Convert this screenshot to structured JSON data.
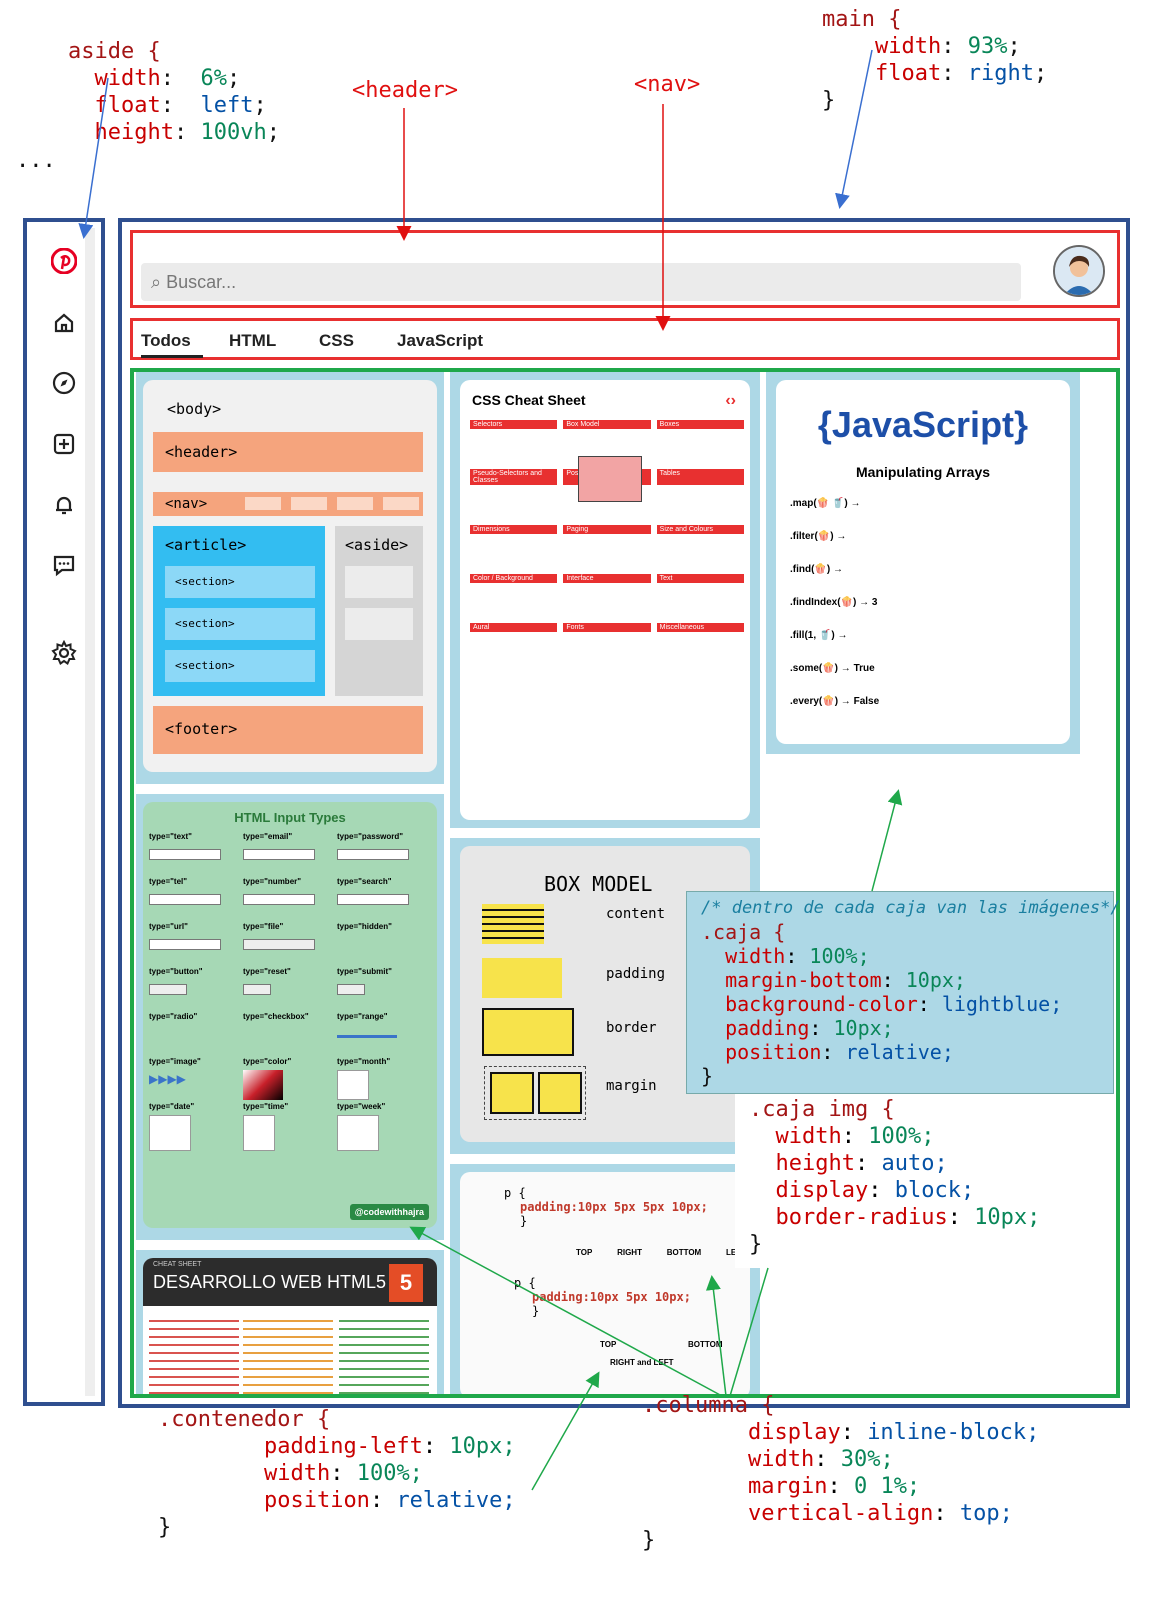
{
  "main_rule": {
    "selector": "main {",
    "l1_prop": "width",
    "l1_val": "93%",
    "l2_prop": "float",
    "l2_val": "right",
    "close": "}"
  },
  "aside_rule": {
    "selector": "aside {",
    "l1_prop": "width",
    "l1_val": "6%",
    "l2_prop": "float",
    "l2_val": "left",
    "l3_prop": "height",
    "l3_val": "100vh",
    "more": "..."
  },
  "labels": {
    "header": "<header>",
    "nav": "<nav>"
  },
  "header": {
    "search_placeholder": "⌕ Buscar..."
  },
  "nav": {
    "tabs": [
      "Todos",
      "HTML",
      "CSS",
      "JavaScript"
    ]
  },
  "aside_icons": [
    "pinterest-logo",
    "home-icon",
    "compass-icon",
    "add-square-icon",
    "bell-icon",
    "message-icon",
    "settings-icon"
  ],
  "images": {
    "layout": {
      "body": "<body>",
      "header": "<header>",
      "nav": "<nav>",
      "article": "<article>",
      "aside": "<aside>",
      "section": "<section>",
      "footer": "<footer>"
    },
    "css_cheat": {
      "title": "CSS Cheat Sheet",
      "sections": [
        "Selectors",
        "Box Model",
        "Boxes",
        "Pseudo-Selectors and Classes",
        "Positioning",
        "Tables",
        "Dimensions",
        "Paging",
        "Size and Colours",
        "Color / Background",
        "Interface",
        "Text",
        "Aural",
        "Fonts",
        "Miscellaneous"
      ]
    },
    "js_arrays": {
      "title": "{JavaScript}",
      "subtitle": "Manipulating Arrays",
      "rows": [
        ".map(🍿 🥤) →",
        ".filter(🍿) →",
        ".find(🍿) →",
        ".findIndex(🍿) → 3",
        ".fill(1, 🥤) →",
        ".some(🍿) → True",
        ".every(🍿) → False"
      ]
    },
    "html_inputs": {
      "title": "HTML Input Types",
      "items": [
        "type=\"text\"",
        "type=\"email\"",
        "type=\"password\"",
        "type=\"tel\"",
        "type=\"number\"",
        "type=\"search\"",
        "type=\"url\"",
        "type=\"file\"",
        "type=\"hidden\"",
        "type=\"button\"",
        "type=\"reset\"",
        "type=\"submit\"",
        "type=\"radio\"",
        "type=\"checkbox\"",
        "type=\"range\"",
        "type=\"image\"",
        "type=\"color\"",
        "type=\"month\"",
        "type=\"date\"",
        "type=\"time\"",
        "type=\"week\""
      ],
      "credit": "@codewithhajra"
    },
    "box_model": {
      "title": "BOX MODEL",
      "labels": [
        "content",
        "padding",
        "border",
        "margin"
      ]
    },
    "padding_demo": {
      "line1": "padding:10px 5px 5px 10px;",
      "labels1": [
        "TOP",
        "RIGHT",
        "BOTTOM",
        "LEFT"
      ],
      "line2": "padding:10px 5px 10px;",
      "labels2": [
        "TOP",
        "BOTTOM",
        "RIGHT and LEFT"
      ]
    },
    "html5": {
      "title": "DESARROLLO WEB HTML5",
      "sub": "CHEAT SHEET"
    }
  },
  "caja_rule": {
    "comment": "/* dentro de cada caja van las imágenes*/",
    "selector": ".caja {",
    "p1": "width",
    "v1": "100%;",
    "p2": "margin-bottom",
    "v2": "10px;",
    "p3": "background-color",
    "v3": "lightblue;",
    "p4": "padding",
    "v4": "10px;",
    "p5": "position",
    "v5": "relative;",
    "close": "}"
  },
  "caja_img_rule": {
    "selector": ".caja img {",
    "p1": "width",
    "v1": "100%;",
    "p2": "height",
    "v2": "auto;",
    "p3": "display",
    "v3": "block;",
    "p4": "border-radius",
    "v4": "10px;",
    "close": "}"
  },
  "contenedor_rule": {
    "selector": ".contenedor {",
    "p1": "padding-left",
    "v1": "10px;",
    "p2": "width",
    "v2": "100%;",
    "p3": "position",
    "v3": "relative;",
    "close": "}"
  },
  "columna_rule": {
    "selector": ".columna {",
    "p1": "display",
    "v1": "inline-block;",
    "p2": "width",
    "v2": "30%;",
    "p3": "margin",
    "v3": "0 1%;",
    "p4": "vertical-align",
    "v4": "top;",
    "close": "}"
  },
  "colors": {
    "frame": "#2f4f8f",
    "header_border": "#e83030",
    "contenedor_border": "#1fa84a",
    "caja_bg": "#add8e6",
    "arrow_blue": "#3a6fd0",
    "arrow_red": "#e01010",
    "arrow_green": "#1fa84a"
  }
}
